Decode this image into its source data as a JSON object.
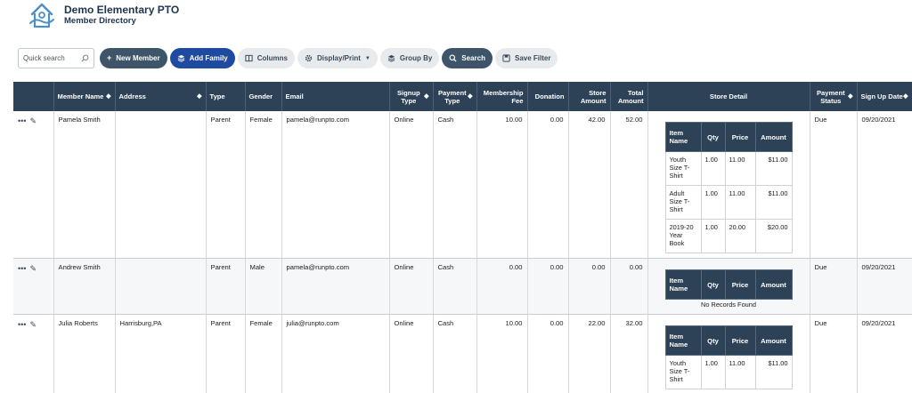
{
  "header": {
    "org_name": "Demo Elementary PTO",
    "subtitle": "Member Directory"
  },
  "toolbar": {
    "search_placeholder": "Quick search",
    "new_member": "New Member",
    "add_family": "Add Family",
    "columns": "Columns",
    "display_print": "Display/Print",
    "group_by": "Group By",
    "search": "Search",
    "save_filter": "Save Filter"
  },
  "columns": {
    "member_name": "Member Name",
    "address": "Address",
    "type": "Type",
    "gender": "Gender",
    "email": "Email",
    "signup_type": "Signup Type",
    "payment_type": "Payment Type",
    "membership_fee": "Membership Fee",
    "donation": "Donation",
    "store_amount": "Store Amount",
    "total_amount": "Total Amount",
    "store_detail": "Store Detail",
    "payment_status": "Payment Status",
    "sign_up_date": "Sign Up Date"
  },
  "store_columns": {
    "item_name": "Item Name",
    "qty": "Qty",
    "price": "Price",
    "amount": "Amount"
  },
  "no_records": "No Records Found",
  "rows": [
    {
      "name": "Pamela Smith",
      "address": "",
      "type": "Parent",
      "gender": "Female",
      "email": "pamela@runpto.com",
      "signup": "Online",
      "payment": "Cash",
      "fee": "10.00",
      "donation": "0.00",
      "store": "42.00",
      "total": "52.00",
      "status": "Due",
      "date": "09/20/2021",
      "items": [
        {
          "name": "Youth Size T-Shirt",
          "qty": "1.00",
          "price": "11.00",
          "amount": "$11.00"
        },
        {
          "name": "Adult Size T-Shirt",
          "qty": "1.00",
          "price": "11.00",
          "amount": "$11.00"
        },
        {
          "name": "2019-20 Year Book",
          "qty": "1.00",
          "price": "20.00",
          "amount": "$20.00"
        }
      ]
    },
    {
      "name": "Andrew Smith",
      "address": "",
      "type": "Parent",
      "gender": "Male",
      "email": "pamela@runpto.com",
      "signup": "Online",
      "payment": "Cash",
      "fee": "0.00",
      "donation": "0.00",
      "store": "0.00",
      "total": "0.00",
      "status": "Due",
      "date": "09/20/2021",
      "items": []
    },
    {
      "name": "Julia Roberts",
      "address": "Harrisburg,PA",
      "type": "Parent",
      "gender": "Female",
      "email": "julia@runpto.com",
      "signup": "Online",
      "payment": "Cash",
      "fee": "10.00",
      "donation": "0.00",
      "store": "22.00",
      "total": "32.00",
      "status": "Due",
      "date": "09/20/2021",
      "items": [
        {
          "name": "Youth Size T-Shirt",
          "qty": "1.00",
          "price": "11.00",
          "amount": "$11.00"
        }
      ]
    }
  ]
}
